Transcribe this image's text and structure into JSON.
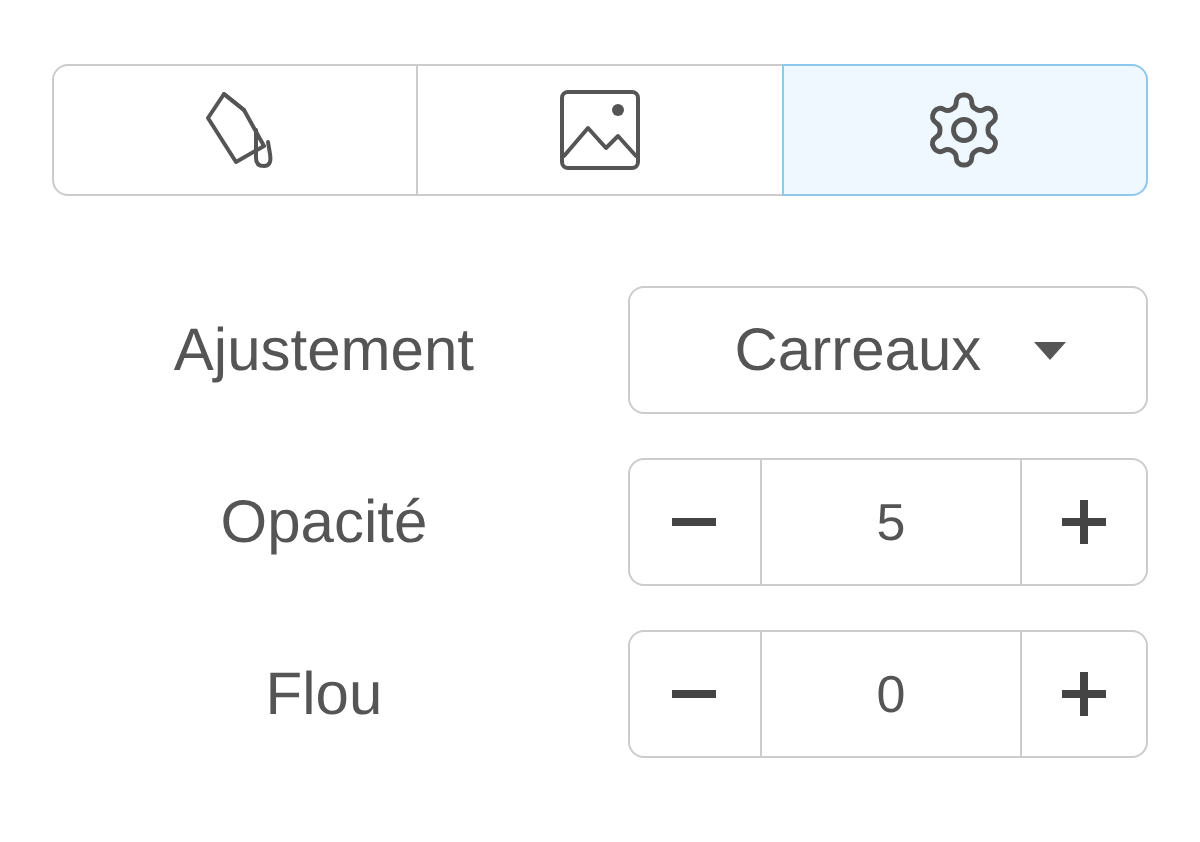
{
  "tabs": [
    {
      "kind": "fill",
      "selected": false
    },
    {
      "kind": "image",
      "selected": false
    },
    {
      "kind": "settings",
      "selected": true
    }
  ],
  "settings": [
    {
      "kind": "select",
      "label": "Ajustement",
      "value": "Carreaux"
    },
    {
      "kind": "stepper",
      "label": "Opacité",
      "value": "5"
    },
    {
      "kind": "stepper",
      "label": "Flou",
      "value": "0"
    }
  ]
}
